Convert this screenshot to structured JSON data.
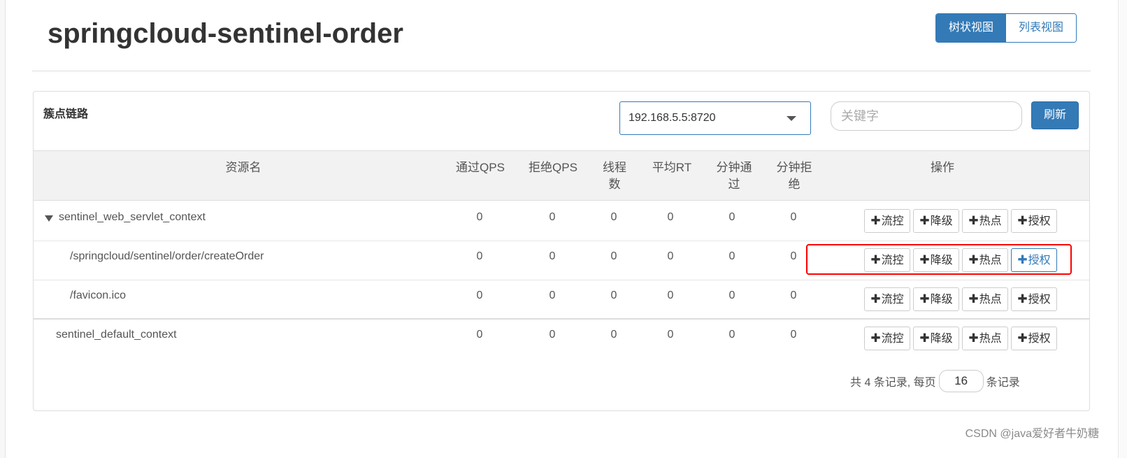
{
  "app": {
    "title": "springcloud-sentinel-order"
  },
  "view_toggle": {
    "tree_label": "树状视图",
    "list_label": "列表视图",
    "active": "tree"
  },
  "panel": {
    "title": "簇点链路",
    "machine_select": {
      "value": "192.168.5.5:8720"
    },
    "search": {
      "placeholder": "关键字",
      "value": ""
    },
    "refresh_label": "刷新"
  },
  "table": {
    "headers": {
      "resource": "资源名",
      "pass_qps": "通过QPS",
      "block_qps": "拒绝QPS",
      "threads": "线程数",
      "avg_rt": "平均RT",
      "minute_pass": "分钟通过",
      "minute_block": "分钟拒绝",
      "ops": "操作"
    },
    "rows": [
      {
        "name": "sentinel_web_servlet_context",
        "pass_qps": "0",
        "block_qps": "0",
        "threads": "0",
        "avg_rt": "0",
        "minute_pass": "0",
        "minute_block": "0"
      },
      {
        "name": "/springcloud/sentinel/order/createOrder",
        "pass_qps": "0",
        "block_qps": "0",
        "threads": "0",
        "avg_rt": "0",
        "minute_pass": "0",
        "minute_block": "0"
      },
      {
        "name": "/favicon.ico",
        "pass_qps": "0",
        "block_qps": "0",
        "threads": "0",
        "avg_rt": "0",
        "minute_pass": "0",
        "minute_block": "0"
      },
      {
        "name": "sentinel_default_context",
        "pass_qps": "0",
        "block_qps": "0",
        "threads": "0",
        "avg_rt": "0",
        "minute_pass": "0",
        "minute_block": "0"
      }
    ],
    "op_labels": {
      "plus": "✚",
      "flow": "流控",
      "degrade": "降级",
      "hot": "热点",
      "auth": "授权"
    }
  },
  "pager": {
    "prefix": "共 4 条记录, 每页",
    "page_size": "16",
    "suffix": "条记录"
  },
  "watermark": "CSDN @java爱好者牛奶糖",
  "colors": {
    "primary": "#337ab7",
    "highlight": "#ff0000",
    "header_bg": "#f2f2f2"
  },
  "icons": {
    "tree_toggle": "caret-down-icon",
    "select_caret": "chevron-down-icon",
    "op_plus": "plus-icon"
  }
}
